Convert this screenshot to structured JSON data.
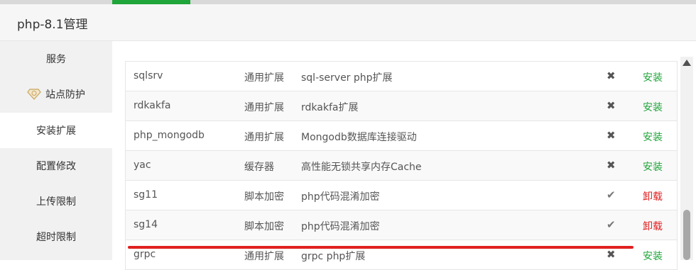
{
  "window": {
    "title": "php-8.1管理"
  },
  "colors": {
    "install": "#20a53a",
    "uninstall": "#e02020",
    "tab_active": "#20a53a",
    "highlight": "#e02020"
  },
  "sidebar": {
    "items": [
      {
        "label": "服务",
        "icon": "",
        "active": false
      },
      {
        "label": "站点防护",
        "icon": "gem-icon",
        "active": false
      },
      {
        "label": "安装扩展",
        "icon": "",
        "active": true
      },
      {
        "label": "配置修改",
        "icon": "",
        "active": false
      },
      {
        "label": "上传限制",
        "icon": "",
        "active": false
      },
      {
        "label": "超时限制",
        "icon": "",
        "active": false
      }
    ]
  },
  "extensions": [
    {
      "name": "sqlsrv",
      "type": "通用扩展",
      "desc": "sql-server php扩展",
      "status": "✖",
      "action": "安装",
      "installed": false
    },
    {
      "name": "rdkakfa",
      "type": "通用扩展",
      "desc": "rdkakfa扩展",
      "status": "✖",
      "action": "安装",
      "installed": false
    },
    {
      "name": "php_mongodb",
      "type": "通用扩展",
      "desc": "Mongodb数据库连接驱动",
      "status": "✖",
      "action": "安装",
      "installed": false
    },
    {
      "name": "yac",
      "type": "缓存器",
      "desc": "高性能无锁共享内存Cache",
      "status": "✖",
      "action": "安装",
      "installed": false
    },
    {
      "name": "sg11",
      "type": "脚本加密",
      "desc": "php代码混淆加密",
      "status": "✔",
      "action": "卸载",
      "installed": true
    },
    {
      "name": "sg14",
      "type": "脚本加密",
      "desc": "php代码混淆加密",
      "status": "✔",
      "action": "卸载",
      "installed": true
    },
    {
      "name": "grpc",
      "type": "通用扩展",
      "desc": "grpc php扩展",
      "status": "✖",
      "action": "安装",
      "installed": false
    }
  ]
}
